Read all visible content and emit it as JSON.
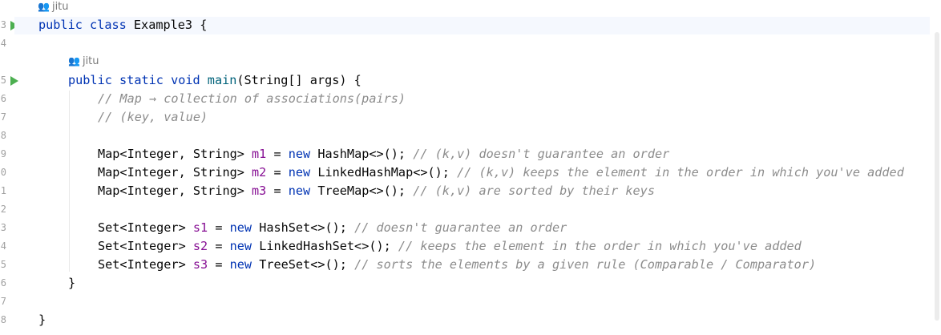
{
  "editor": {
    "line_numbers": [
      "3",
      "4",
      "5",
      "6",
      "7",
      "8",
      "9",
      "0",
      "1",
      "2",
      "3",
      "4",
      "5",
      "6",
      "7",
      "8"
    ],
    "author_hints": [
      "jitu",
      "jitu"
    ],
    "class_decl": {
      "kw1": "public",
      "kw2": "class",
      "name": "Example3",
      "brace": "{"
    },
    "main_decl": {
      "kw1": "public",
      "kw2": "static",
      "kw3": "void",
      "name": "main",
      "params": "(String[] args) {"
    },
    "comments": {
      "c1": "// Map → collection of associations(pairs)",
      "c2": "// (key, value)"
    },
    "statements": [
      {
        "type": "Map<Integer, String> ",
        "var": "m1",
        "mid": " = ",
        "kw": "new",
        "ctor": " HashMap<>();",
        "comment": " // (k,v) doesn't guarantee an order"
      },
      {
        "type": "Map<Integer, String> ",
        "var": "m2",
        "mid": " = ",
        "kw": "new",
        "ctor": " LinkedHashMap<>();",
        "comment": " // (k,v) keeps the element in the order in which you've added"
      },
      {
        "type": "Map<Integer, String> ",
        "var": "m3",
        "mid": " = ",
        "kw": "new",
        "ctor": " TreeMap<>();",
        "comment": " // (k,v) are sorted by their keys"
      },
      {
        "type": "Set<Integer> ",
        "var": "s1",
        "mid": " = ",
        "kw": "new",
        "ctor": " HashSet<>();",
        "comment": " // doesn't guarantee an order"
      },
      {
        "type": "Set<Integer> ",
        "var": "s2",
        "mid": " = ",
        "kw": "new",
        "ctor": " LinkedHashSet<>();",
        "comment": " // keeps the element in the order in which you've added"
      },
      {
        "type": "Set<Integer> ",
        "var": "s3",
        "mid": " = ",
        "kw": "new",
        "ctor": " TreeSet<>();",
        "comment": " // sorts the elements by a given rule (Comparable / Comparator)"
      }
    ],
    "close_brace": "}"
  }
}
